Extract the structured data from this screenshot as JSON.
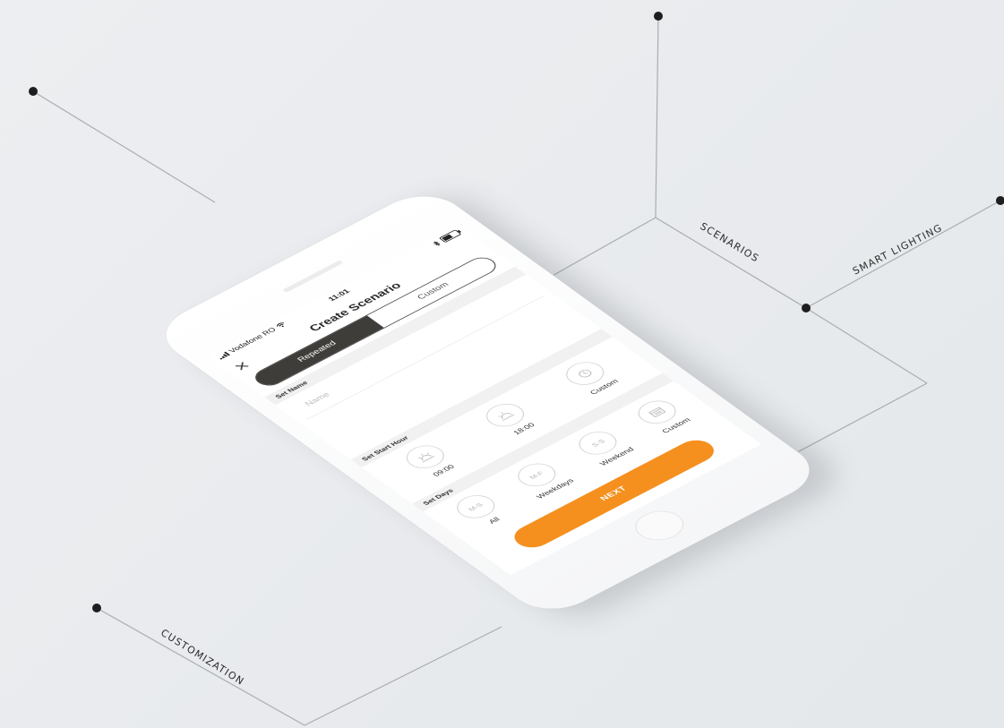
{
  "callouts": {
    "scenarios": "SCENARIOS",
    "smart_lighting": "SMART LIGHTING",
    "customization": "CUSTOMIZATION"
  },
  "status_bar": {
    "carrier": "Vodafone RO",
    "time": "11:01",
    "wifi_icon": "wifi-icon",
    "bluetooth_icon": "bluetooth-icon",
    "battery_icon": "battery-icon"
  },
  "nav": {
    "title": "Create Scenario",
    "close_icon": "close-icon"
  },
  "segment": {
    "repeated": "Repeated",
    "custom": "Custom"
  },
  "set_name": {
    "header": "Set Name",
    "placeholder": "Name"
  },
  "set_start_hour": {
    "header": "Set Start Hour",
    "options": [
      {
        "icon": "sunrise-icon",
        "label": "09:00"
      },
      {
        "icon": "sunset-icon",
        "label": "18:00"
      },
      {
        "icon": "clock-icon",
        "label": "Custom"
      }
    ]
  },
  "set_days": {
    "header": "Set Days",
    "options": [
      {
        "badge": "M-S",
        "label": "All"
      },
      {
        "badge": "M-F",
        "label": "Weekdays"
      },
      {
        "badge": "S-S",
        "label": "Weekend"
      },
      {
        "icon": "calendar-icon",
        "label": "Custom"
      }
    ]
  },
  "next_button": "NEXT",
  "colors": {
    "accent": "#f5901e",
    "segment_active": "#3e3d39",
    "background": "#eceef1"
  }
}
